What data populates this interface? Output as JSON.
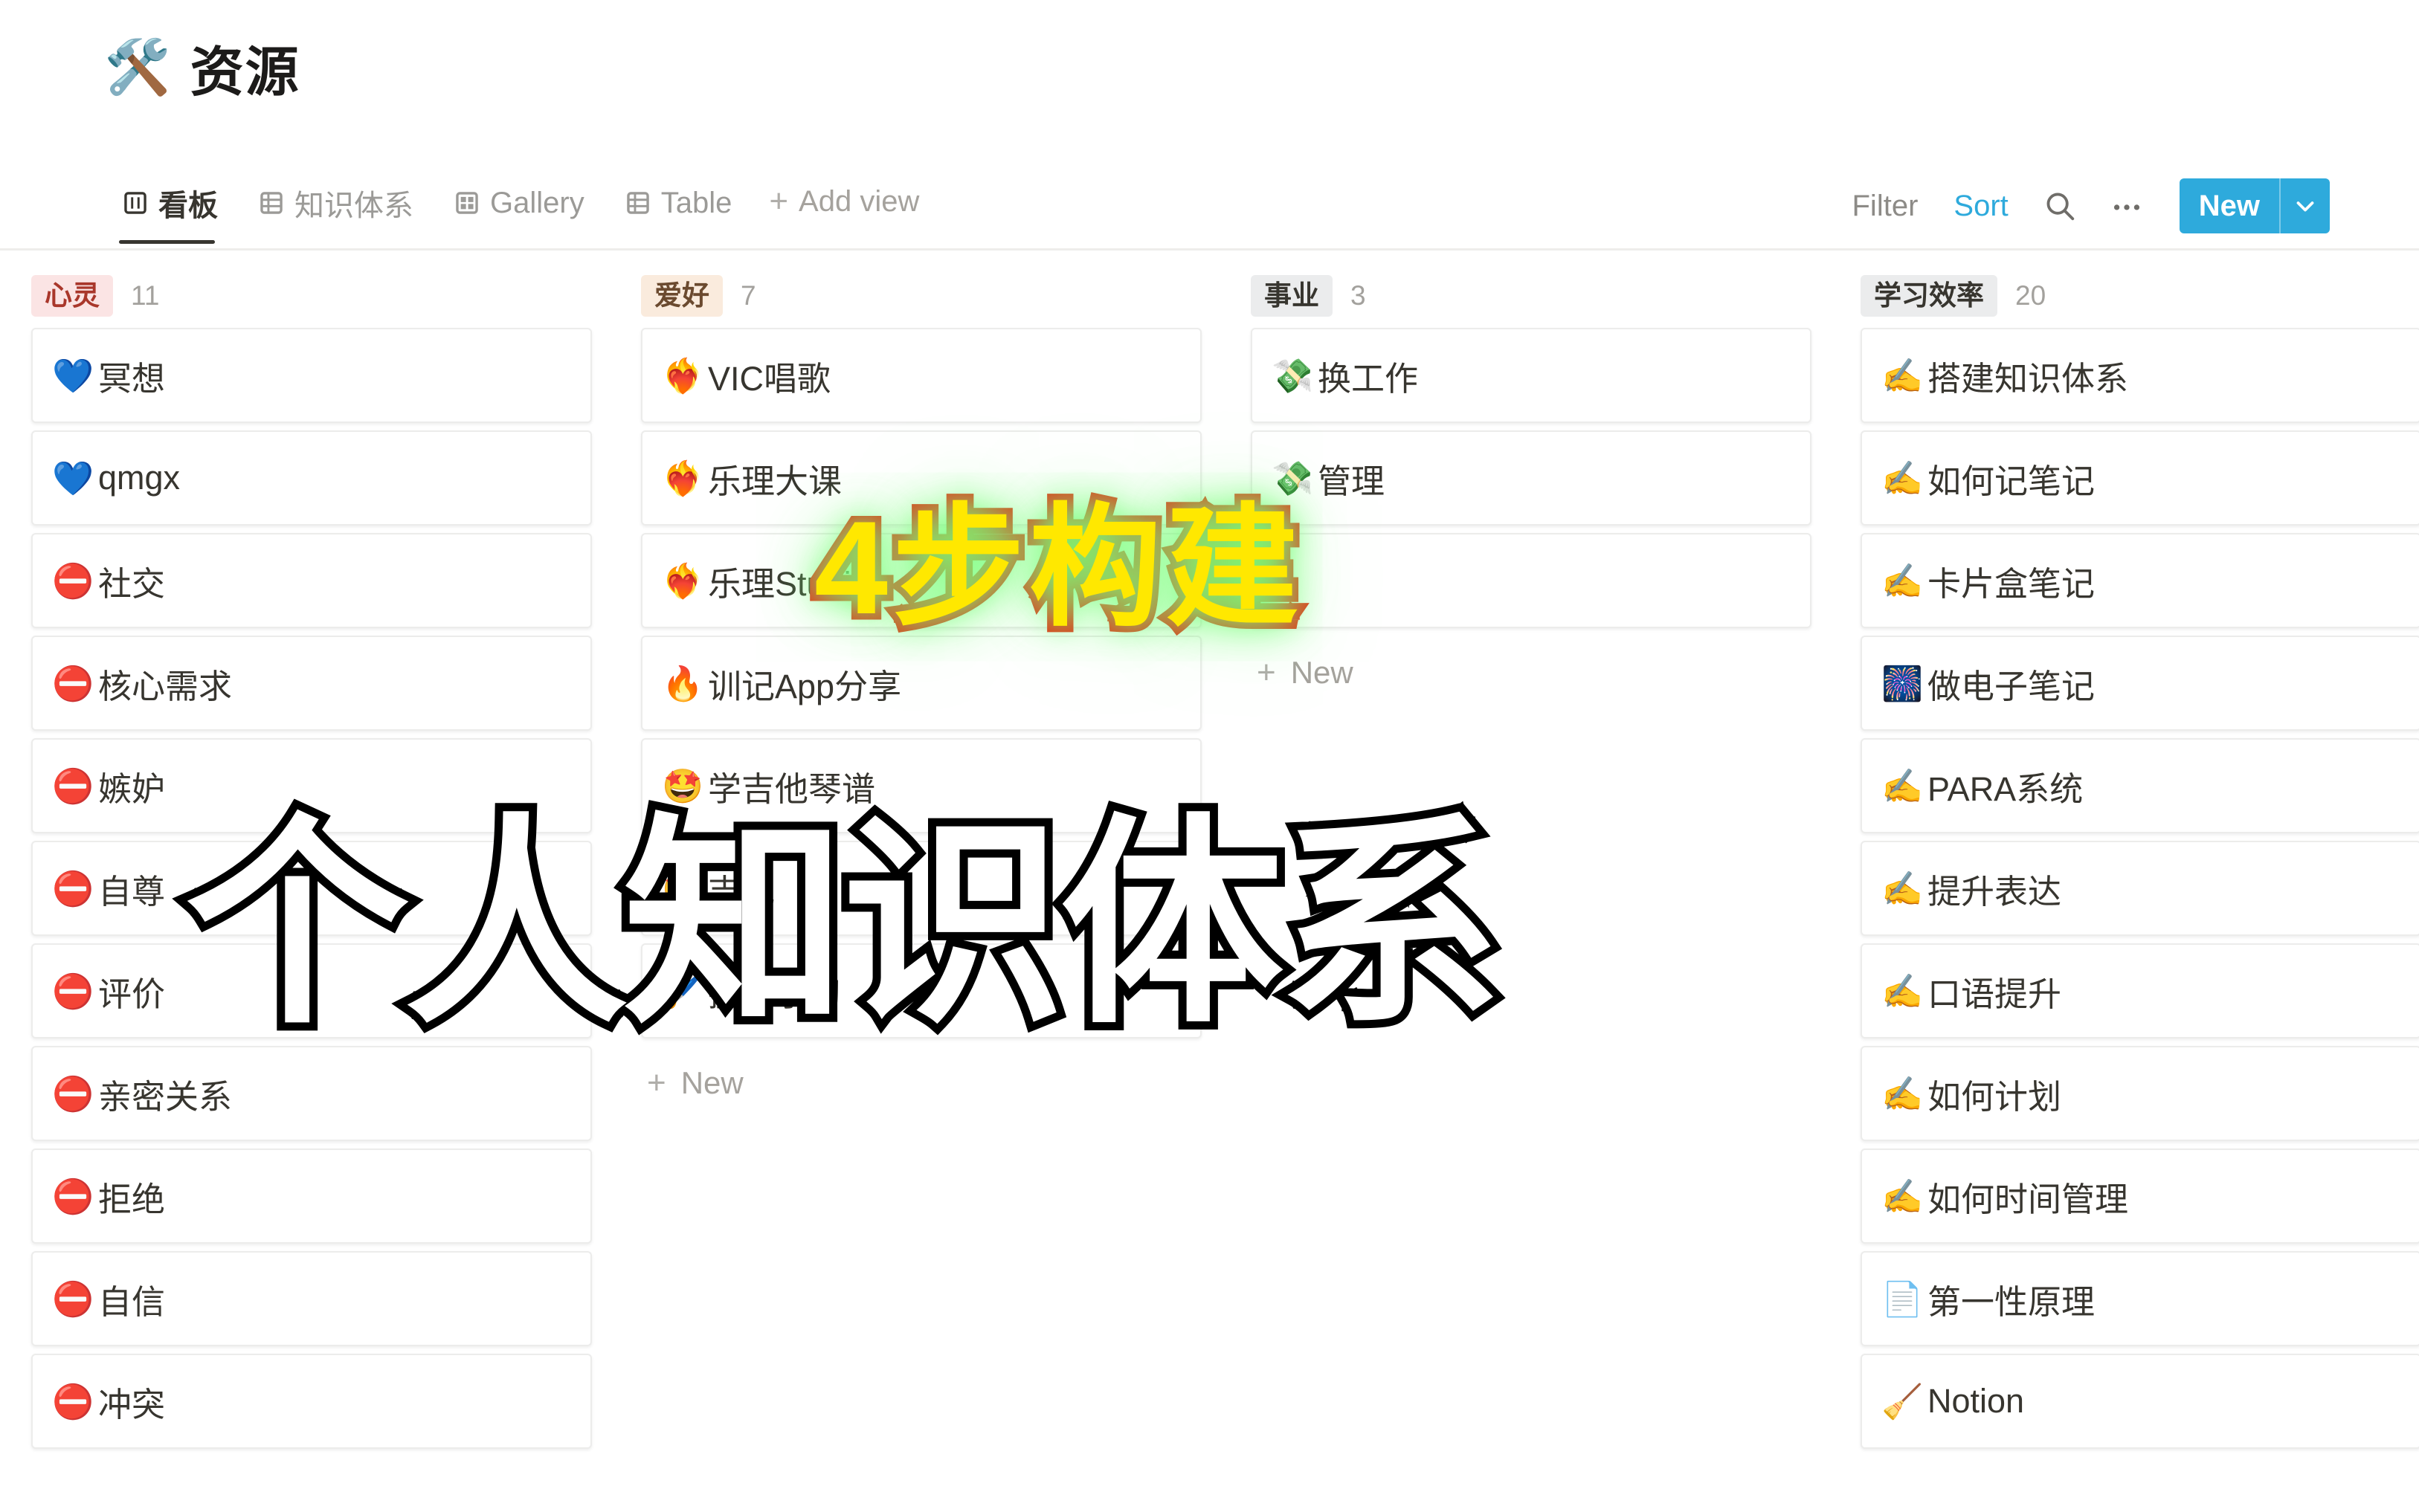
{
  "page": {
    "emoji": "🛠️",
    "title": "资源"
  },
  "views": {
    "tabs": [
      {
        "label": "看板",
        "icon": "board-view-icon",
        "active": true
      },
      {
        "label": "知识体系",
        "icon": "table-view-icon",
        "active": false
      },
      {
        "label": "Gallery",
        "icon": "gallery-view-icon",
        "active": false
      },
      {
        "label": "Table",
        "icon": "table-view-icon",
        "active": false
      }
    ],
    "add_view_label": "Add view"
  },
  "toolbar": {
    "filter_label": "Filter",
    "sort_label": "Sort",
    "search_icon": "search-icon",
    "more_icon": "ellipsis-icon",
    "new_label": "New",
    "new_caret_icon": "chevron-down-icon",
    "accent_color": "#2eaadc"
  },
  "board": {
    "new_label": "New",
    "columns": [
      {
        "name": "心灵",
        "count": "11",
        "chip_bg": "#fbe4e4",
        "chip_fg": "#a9372b",
        "show_new": false,
        "cards": [
          {
            "emoji": "💙",
            "title": "冥想"
          },
          {
            "emoji": "💙",
            "title": "qmgx"
          },
          {
            "emoji": "⛔",
            "title": "社交"
          },
          {
            "emoji": "⛔",
            "title": "核心需求"
          },
          {
            "emoji": "⛔",
            "title": "嫉妒"
          },
          {
            "emoji": "⛔",
            "title": "自尊"
          },
          {
            "emoji": "⛔",
            "title": "评价"
          },
          {
            "emoji": "⛔",
            "title": "亲密关系"
          },
          {
            "emoji": "⛔",
            "title": "拒绝"
          },
          {
            "emoji": "⛔",
            "title": "自信"
          },
          {
            "emoji": "⛔",
            "title": "冲突"
          }
        ]
      },
      {
        "name": "爱好",
        "count": "7",
        "chip_bg": "#faebdd",
        "chip_fg": "#6b4a2f",
        "show_new": true,
        "cards": [
          {
            "emoji": "❤️‍🔥",
            "title": "VIC唱歌"
          },
          {
            "emoji": "❤️‍🔥",
            "title": "乐理大课"
          },
          {
            "emoji": "❤️‍🔥",
            "title": "乐理Studio"
          },
          {
            "emoji": "🔥",
            "title": "训记App分享"
          },
          {
            "emoji": "🤩",
            "title": "学吉他琴谱"
          },
          {
            "emoji": "🤩",
            "title": "吉他"
          },
          {
            "emoji": "🖌️",
            "title": "摄影学习"
          }
        ]
      },
      {
        "name": "事业",
        "count": "3",
        "chip_bg": "#ebeced",
        "chip_fg": "#37352f",
        "show_new": true,
        "cards": [
          {
            "emoji": "💸",
            "title": "换工作"
          },
          {
            "emoji": "💸",
            "title": "管理"
          },
          {
            "emoji": "",
            "title": ""
          }
        ]
      },
      {
        "name": "学习效率",
        "count": "20",
        "chip_bg": "#ebeced",
        "chip_fg": "#37352f",
        "show_new": false,
        "cards": [
          {
            "emoji": "✍️",
            "title": "搭建知识体系"
          },
          {
            "emoji": "✍️",
            "title": "如何记笔记"
          },
          {
            "emoji": "✍️",
            "title": "卡片盒笔记"
          },
          {
            "emoji": "🎆",
            "title": "做电子笔记"
          },
          {
            "emoji": "✍️",
            "title": "PARA系统"
          },
          {
            "emoji": "✍️",
            "title": "提升表达"
          },
          {
            "emoji": "✍️",
            "title": "口语提升"
          },
          {
            "emoji": "✍️",
            "title": "如何计划"
          },
          {
            "emoji": "✍️",
            "title": "如何时间管理"
          },
          {
            "emoji": "📄",
            "title": "第一性原理"
          },
          {
            "emoji": "🧹",
            "title": "Notion"
          }
        ]
      }
    ]
  },
  "overlays": {
    "headline": "4步构建",
    "subhead": "个人知识体系",
    "headline_fill": "#ffe800",
    "headline_stroke": "#ee2211",
    "subhead_fill": "#ffffff",
    "subhead_stroke": "#000000"
  }
}
